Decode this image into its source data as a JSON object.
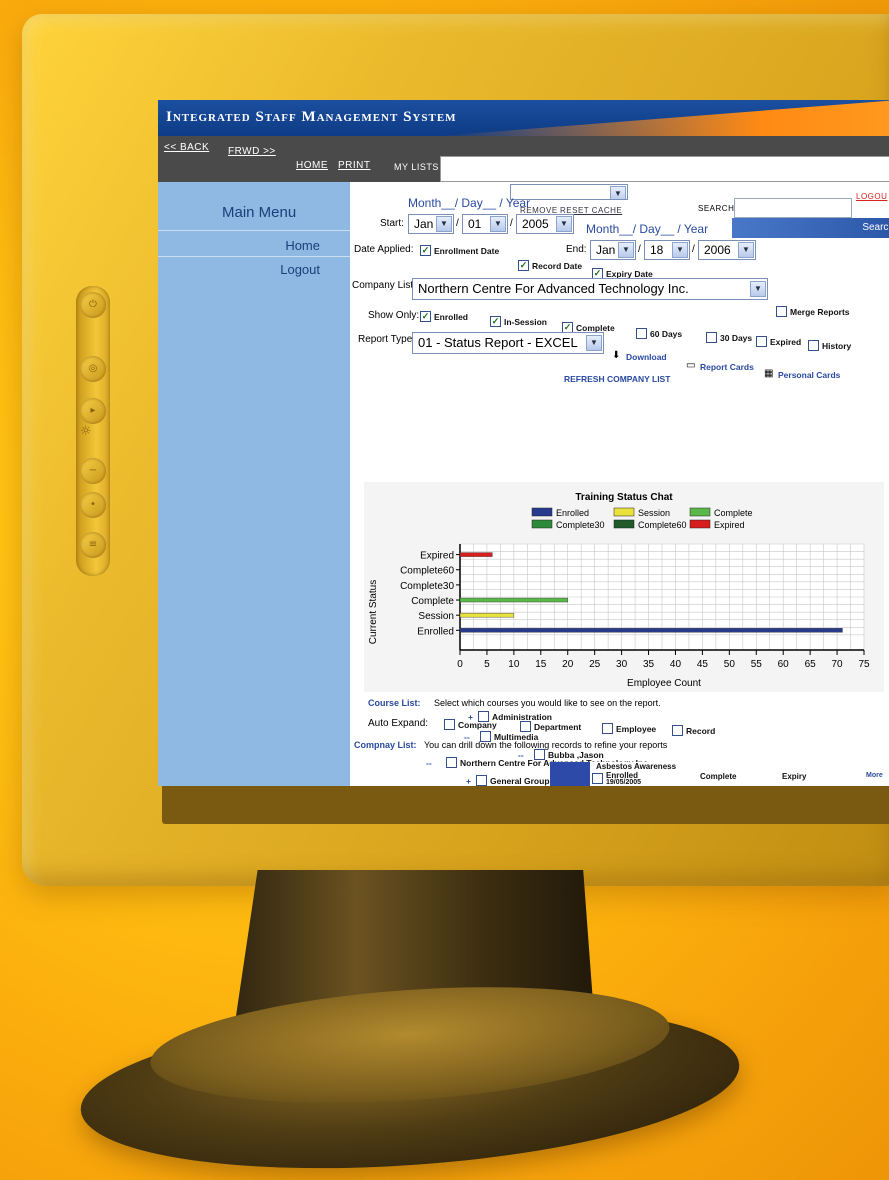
{
  "app": {
    "title": "Integrated Staff Management System",
    "colors": {
      "titlebar": "#0e3b85",
      "accent_orange": "#ff8a14",
      "sidebar": "#8fb8e3",
      "nav": "#4a4a4a"
    }
  },
  "nav": {
    "back": "<< BACK",
    "forward": "FRWD >>",
    "home": "HOME",
    "print": "PRINT",
    "my_lists_label": "MY LISTS"
  },
  "sidebar": {
    "title": "Main Menu",
    "items": [
      {
        "label": "Home"
      },
      {
        "label": "Logout"
      }
    ]
  },
  "toolbar": {
    "remove": "REMOVE",
    "reset_cache": "RESET CACHE",
    "search_label": "SEARCH",
    "logout": "LOGOU",
    "search_button": "Search"
  },
  "dates": {
    "start_header": "Month__/ Day__ / Year",
    "end_header": "Month__/ Day__ / Year",
    "start_label": "Start:",
    "start_month": "Jan",
    "start_day": "01",
    "start_year": "2005",
    "end_label": "End:",
    "end_month": "Jan",
    "end_day": "18",
    "end_year": "2006"
  },
  "filters": {
    "date_applied_label": "Date Applied:",
    "enrollment_date": "Enrollment Date",
    "record_date": "Record Date",
    "expiry_date": "Expiry Date",
    "company_list_label": "Company List:",
    "company_value": "Northern Centre For Advanced Technology Inc.",
    "merge_reports": "Merge Reports",
    "show_only_label": "Show Only:",
    "enrolled": "Enrolled",
    "in_session": "In-Session",
    "complete": "Complete",
    "days60": "60 Days",
    "days30": "30 Days",
    "expired": "Expired",
    "history": "History",
    "report_type_label": "Report Type:",
    "report_type_value": "01 - Status Report - EXCEL",
    "download": "Download",
    "report_cards": "Report Cards",
    "personal_cards": "Personal Cards",
    "refresh": "REFRESH COMPANY LIST"
  },
  "chart_data": {
    "type": "bar",
    "orientation": "horizontal",
    "title": "Training Status Chat",
    "xlabel": "Employee Count",
    "ylabel": "Current Status",
    "categories": [
      "Expired",
      "Complete60",
      "Complete30",
      "Complete",
      "Session",
      "Enrolled"
    ],
    "values": [
      6,
      0,
      0,
      20,
      10,
      71
    ],
    "colors": [
      "#d81d1d",
      "#1e5a2a",
      "#2c8a3a",
      "#58b848",
      "#e8e23c",
      "#283a8c"
    ],
    "xlim": [
      0,
      75
    ],
    "xticks": [
      0,
      5,
      10,
      15,
      20,
      25,
      30,
      35,
      40,
      45,
      50,
      55,
      60,
      65,
      70,
      75
    ],
    "grid": true,
    "legend_position": "top",
    "legend": [
      {
        "name": "Enrolled",
        "color": "#283a8c"
      },
      {
        "name": "Complete30",
        "color": "#2c8a3a"
      },
      {
        "name": "Session",
        "color": "#e8e23c"
      },
      {
        "name": "Complete60",
        "color": "#1e5a2a"
      },
      {
        "name": "Complete",
        "color": "#58b848"
      },
      {
        "name": "Expired",
        "color": "#d81d1d"
      }
    ]
  },
  "lists": {
    "course_list_label": "Course List:",
    "course_list_text": "Select which courses you would like to see on the report.",
    "auto_expand_label": "Auto Expand:",
    "expand_company": "Company",
    "expand_department": "Department",
    "expand_employee": "Employee",
    "expand_record": "Record",
    "company_list_label": "Compnay List:",
    "company_list_text": "You can drill down the following records to refine your reports"
  },
  "tree": {
    "root": "Northern Centre For Advanced Technology Inc.",
    "general_grouping": "General Grouping -(Northern Centre For Advanced Technology Inc.)",
    "administration": "Administration",
    "multimedia": "Multimedia",
    "employee": "Bubba ,Jason",
    "collapse_sign": "--",
    "expand_sign": "+"
  },
  "detail": {
    "course": "Asbestos Awareness",
    "status_enrolled": "Enrolled",
    "date": "19/05/2005",
    "col_complete": "Complete",
    "col_expiry": "Expiry",
    "more": "More"
  },
  "hardware": {
    "icons": [
      "power-icon",
      "mode-icon",
      "right-arrow-icon",
      "brightness-icon",
      "minus-icon",
      "select-icon",
      "menu-icon"
    ]
  }
}
